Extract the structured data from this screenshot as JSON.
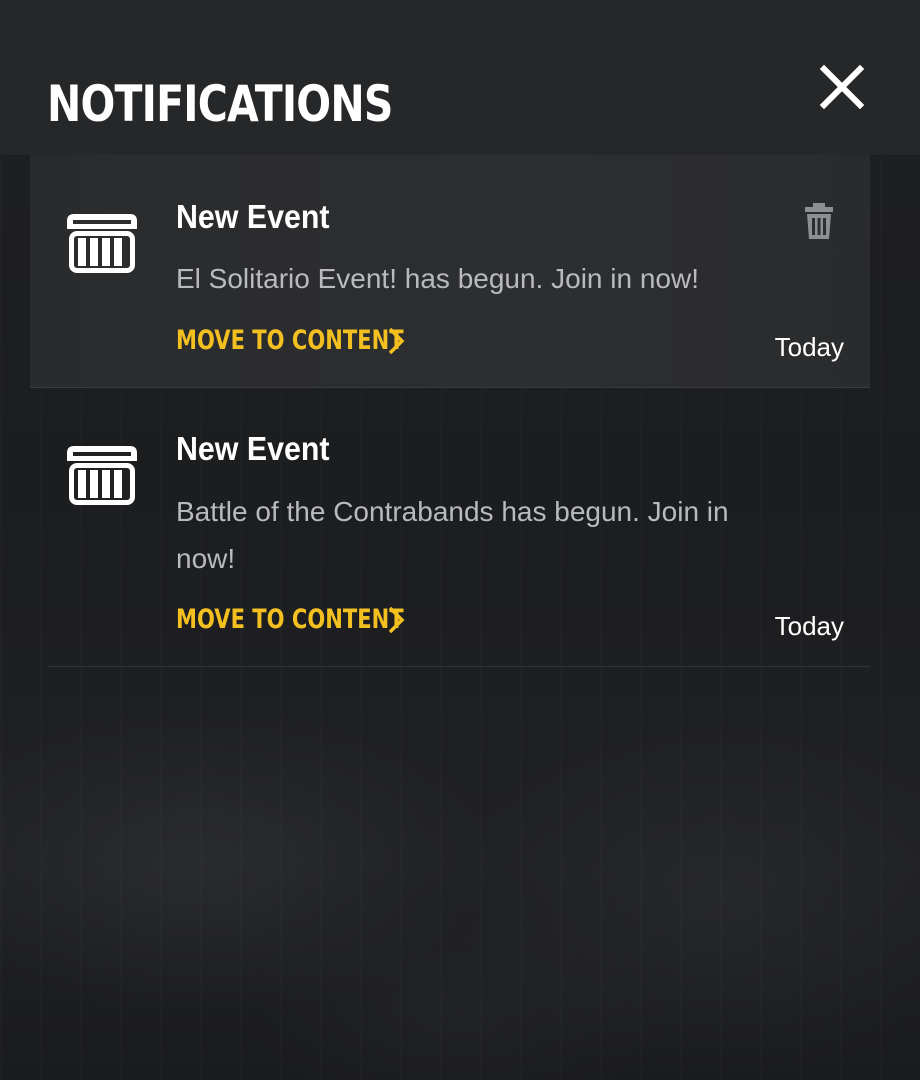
{
  "header": {
    "title": "NOTIFICATIONS"
  },
  "icons": {
    "close": "close-icon",
    "event": "gift-box-icon",
    "trash": "trash-icon",
    "chevron": "chevron-right-icon"
  },
  "colors": {
    "accent": "#f4c020",
    "text_primary": "#ffffff",
    "text_secondary": "#b9babc",
    "header_bg": "#262729",
    "active_item_bg": "#2c2d2f"
  },
  "notifications": [
    {
      "title": "New Event",
      "body": "El Solitario Event! has begun. Join in now!",
      "action_label": "MOVE TO CONTENT",
      "date": "Today",
      "selected": true
    },
    {
      "title": "New Event",
      "body": "Battle of the Contrabands has begun. Join in now!",
      "action_label": "MOVE TO CONTENT",
      "date": "Today",
      "selected": false
    }
  ]
}
